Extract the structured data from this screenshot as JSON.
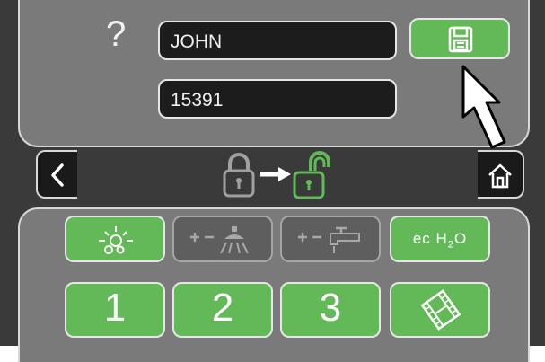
{
  "user": {
    "name_value": "JOHN",
    "code_value": "15391",
    "help_symbol": "?"
  },
  "number_buttons": [
    {
      "label": "1"
    },
    {
      "label": "2"
    },
    {
      "label": "3"
    }
  ],
  "ech2o_button": {
    "label_prefix": "ec",
    "label_h": "H",
    "label_sub": "2",
    "label_o": "O"
  },
  "icons": {
    "save": "floppy-disk-icon",
    "back": "chevron-left-icon",
    "home": "home-icon",
    "lock": "lock-to-unlock-icon",
    "light": "light-bubbles-icon",
    "shower": "shower-plus-minus-icon",
    "faucet": "faucet-plus-minus-icon",
    "film": "film-strip-icon",
    "pointer": "arrow-pointer-icon"
  },
  "colors": {
    "accent_green": "#63b857",
    "panel_gray": "#7a7a7a",
    "screen_dark": "#3a3a3a"
  }
}
